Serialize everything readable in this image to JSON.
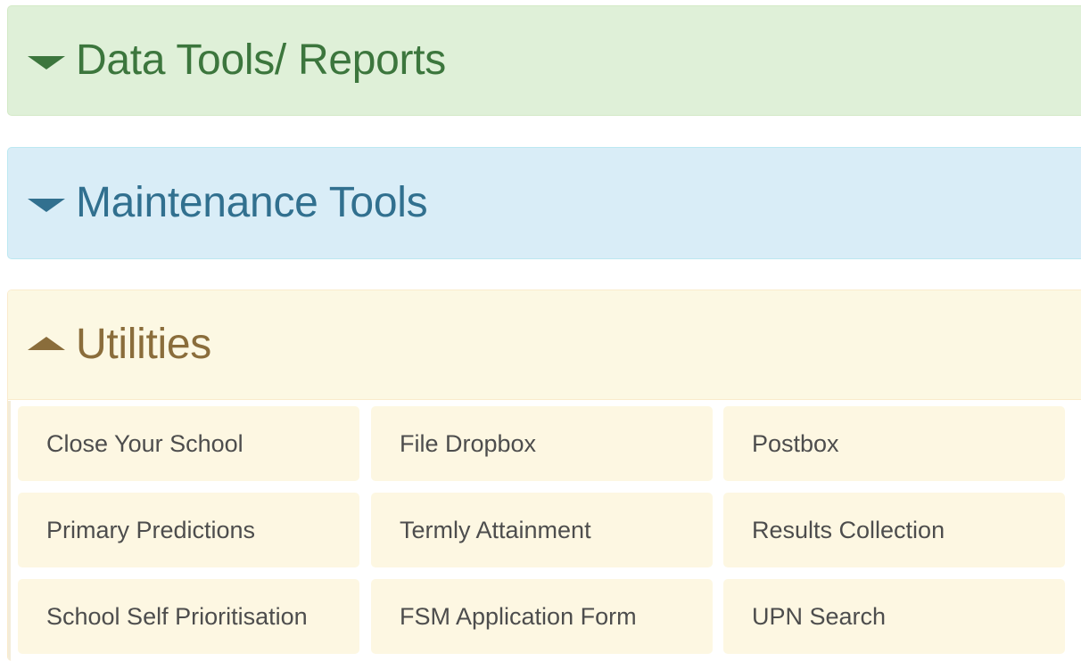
{
  "panels": {
    "data_tools": {
      "title": "Data Tools/ Reports",
      "expanded": false,
      "color": "#3c763d",
      "background": "#dff0d8"
    },
    "maintenance": {
      "title": "Maintenance Tools",
      "expanded": false,
      "color": "#31708f",
      "background": "#d9edf7"
    },
    "utilities": {
      "title": "Utilities",
      "expanded": true,
      "color": "#8a6d3b",
      "background": "#fcf8e3",
      "items": [
        {
          "label": "Close Your School"
        },
        {
          "label": "File Dropbox"
        },
        {
          "label": "Postbox"
        },
        {
          "label": "Primary Predictions"
        },
        {
          "label": "Termly Attainment"
        },
        {
          "label": "Results Collection"
        },
        {
          "label": "School Self Prioritisation"
        },
        {
          "label": "FSM Application Form"
        },
        {
          "label": "UPN Search"
        }
      ]
    }
  },
  "icons": {
    "collapsed": "caret-down-icon",
    "expanded": "caret-up-icon"
  }
}
